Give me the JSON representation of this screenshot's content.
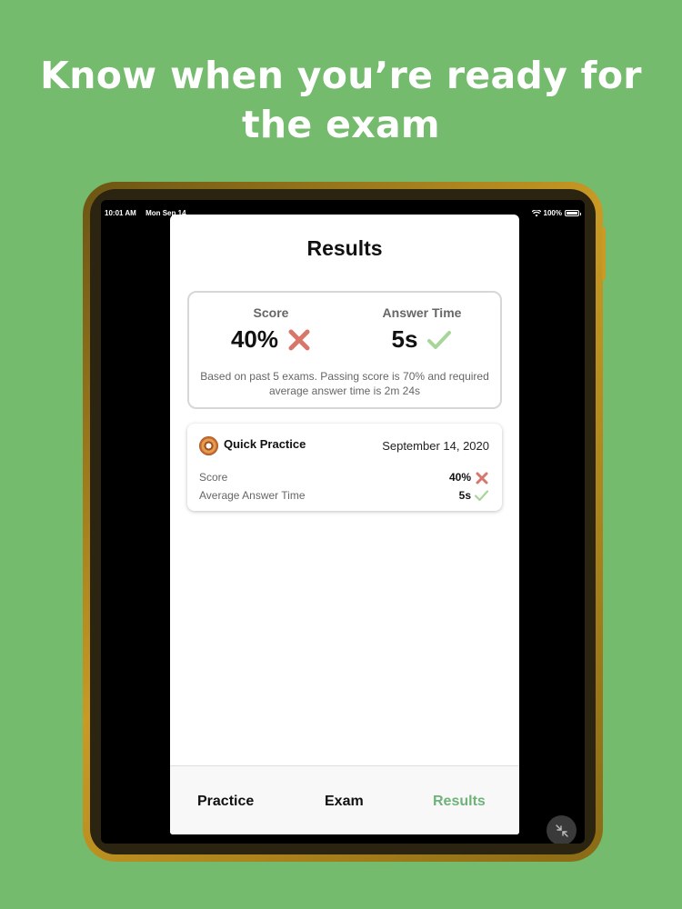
{
  "headline": {
    "line1": "Know when you’re ready for",
    "line2": "the exam"
  },
  "status_bar": {
    "time": "10:01 AM",
    "date": "Mon Sep 14",
    "battery": "100%"
  },
  "results": {
    "title": "Results",
    "summary": {
      "score_label": "Score",
      "score_value": "40%",
      "score_status": "fail",
      "time_label": "Answer Time",
      "time_value": "5s",
      "time_status": "pass",
      "note": "Based on past 5 exams. Passing score is 70% and required average answer time is 2m 24s"
    },
    "sessions": [
      {
        "name": "Quick Practice",
        "date": "September 14, 2020",
        "score_label": "Score",
        "score_value": "40%",
        "avg_time_label": "Average Answer Time",
        "avg_time_value": "5s"
      }
    ]
  },
  "tabs": {
    "practice": "Practice",
    "exam": "Exam",
    "results": "Results",
    "active": "results"
  },
  "colors": {
    "background": "#74bb6d",
    "fail": "#d9766b",
    "pass": "#a9d59a",
    "active_tab": "#6fb27a"
  },
  "icons": {
    "fail": "x-mark-icon",
    "pass": "check-mark-icon",
    "wifi": "wifi-icon",
    "battery": "battery-icon",
    "collapse": "collapse-arrows-icon",
    "session": "donut-icon"
  }
}
